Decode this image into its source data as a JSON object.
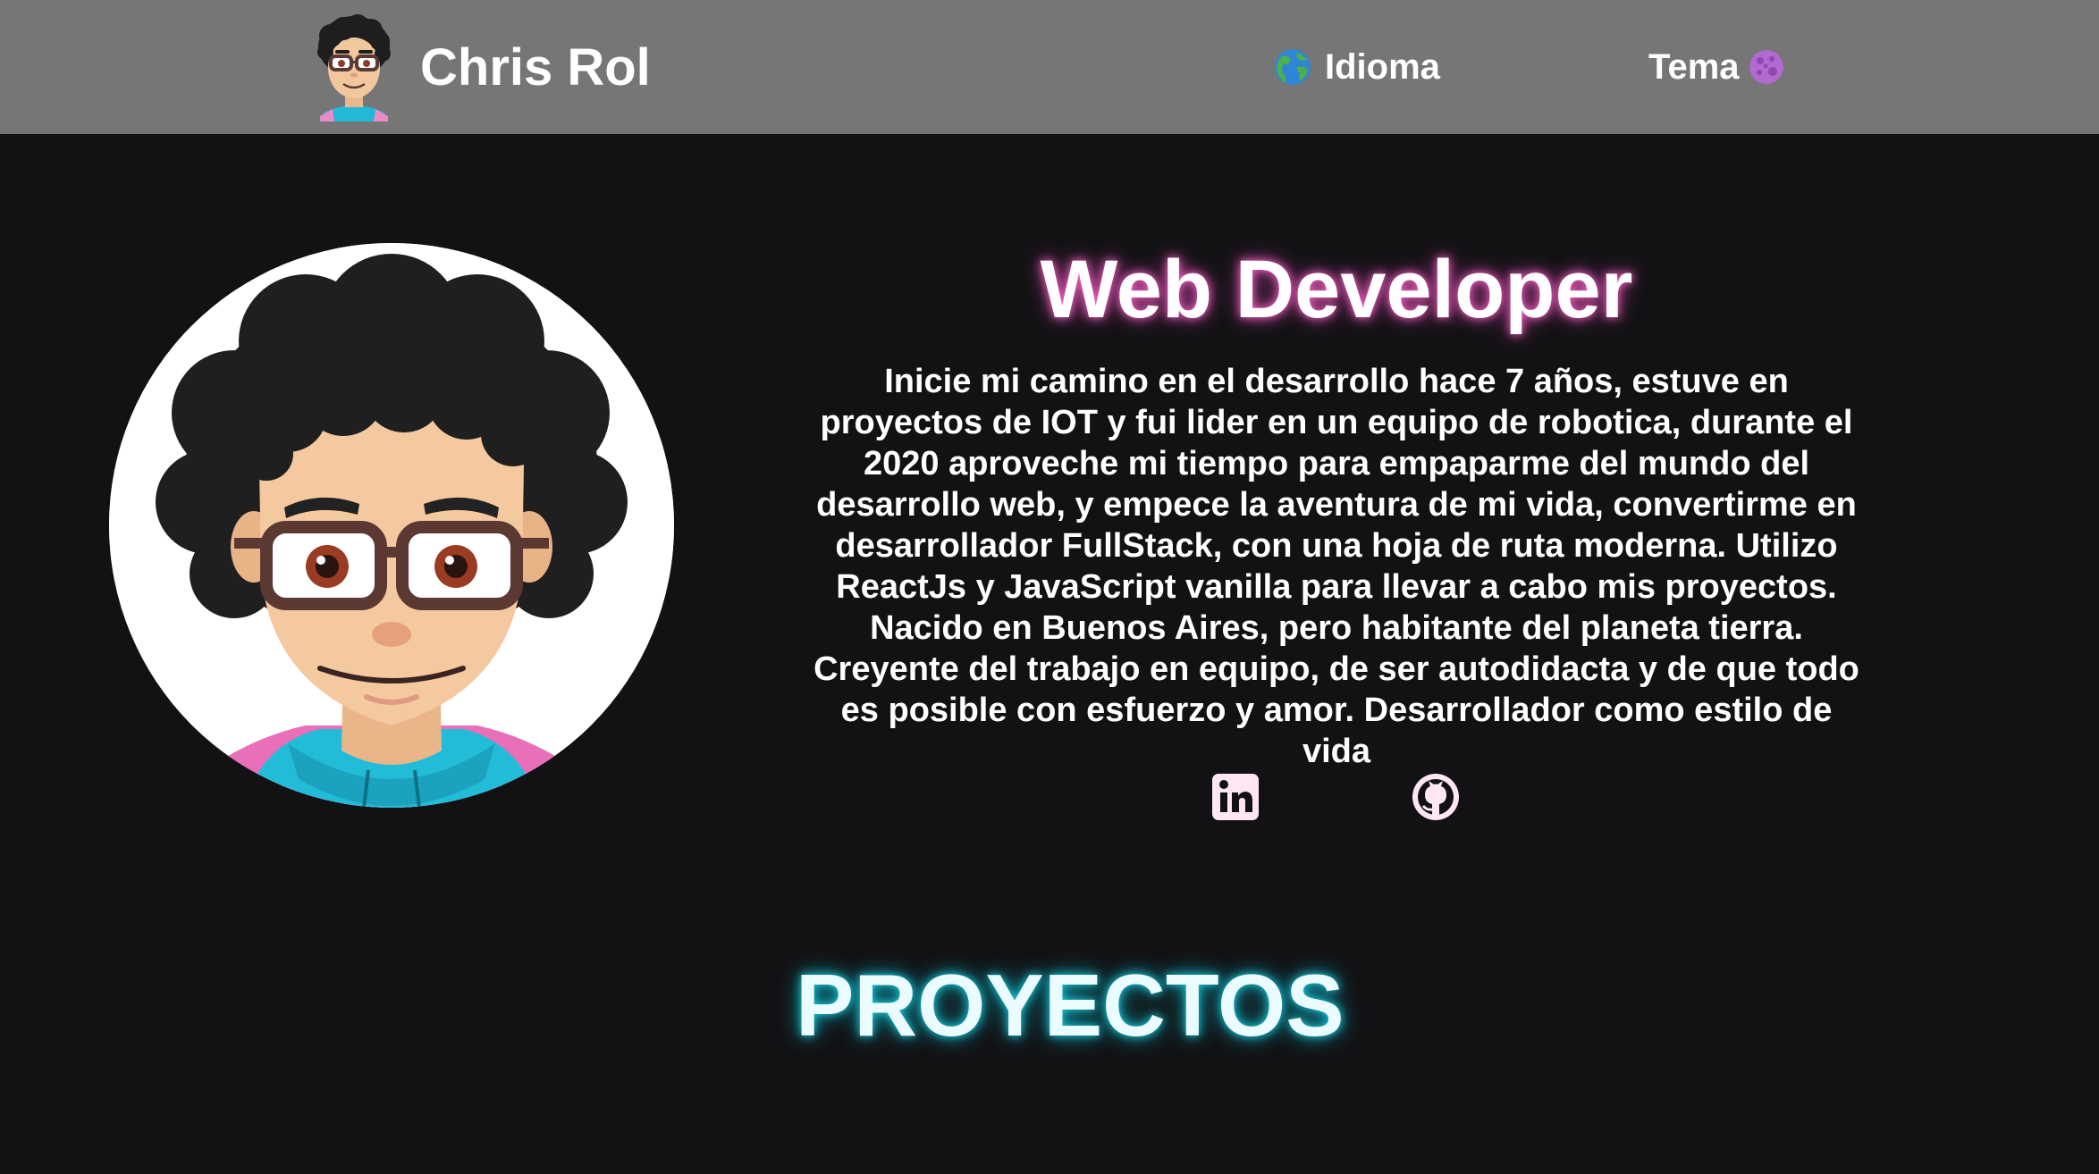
{
  "header": {
    "brand_name": "Chris Rol",
    "language_label": "Idioma",
    "theme_label": "Tema"
  },
  "hero": {
    "title": "Web Developer",
    "description": "Inicie mi camino en el desarrollo hace 7 años, estuve en proyectos de IOT y fui lider en un equipo de robotica, durante el 2020 aproveche mi tiempo para empaparme del mundo del desarrollo web, y empece la aventura de mi vida, convertirme en desarrollador FullStack, con una hoja de ruta moderna. Utilizo ReactJs y JavaScript vanilla para llevar a cabo mis proyectos. Nacido en Buenos Aires, pero habitante del planeta tierra. Creyente del trabajo en equipo, de ser autodidacta y de que todo es posible con esfuerzo y amor. Desarrollador como estilo de vida"
  },
  "social": {
    "icons": [
      "linkedin-icon",
      "github-icon"
    ]
  },
  "projects": {
    "title": "PROYECTOS"
  },
  "colors": {
    "navbar_bg": "#767676",
    "page_bg": "#121214",
    "title_glow": "#ff66cc",
    "section_glow": "#19d3e6",
    "icon_pink": "#ffe6f5"
  },
  "icons": {
    "language": "globe-icon",
    "theme": "purple-moon-icon"
  }
}
